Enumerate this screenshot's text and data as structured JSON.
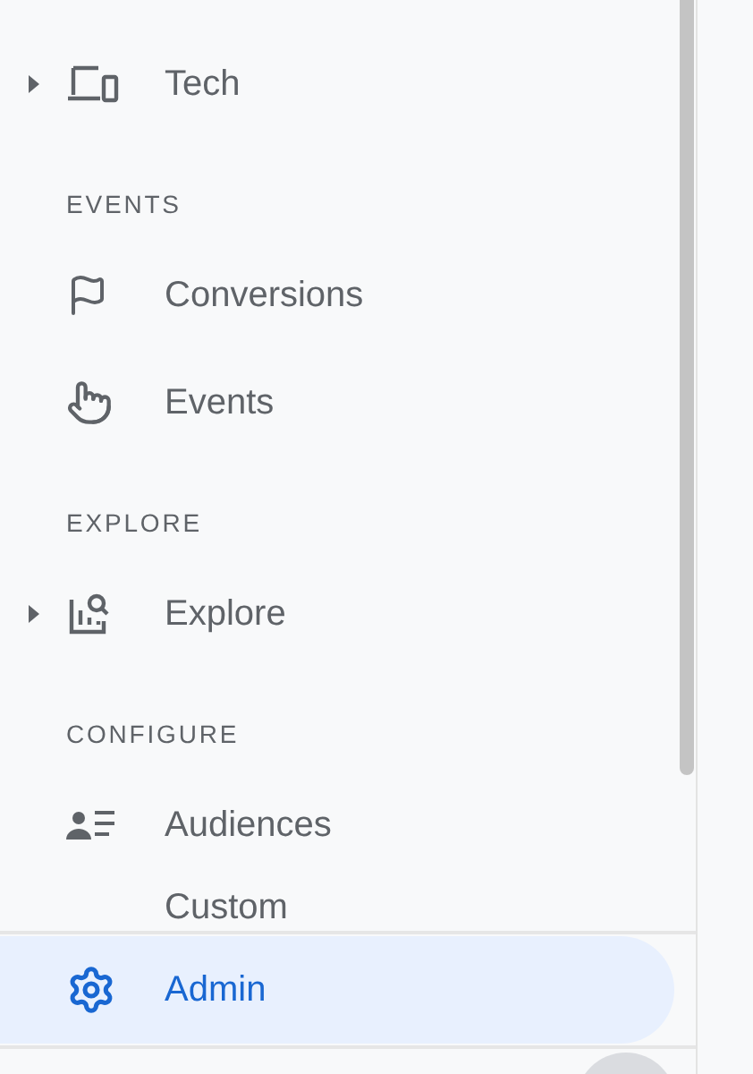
{
  "nav": [
    {
      "kind": "group",
      "label": "Tech",
      "expanded": false,
      "selected": false
    },
    {
      "kind": "header",
      "label": "EVENTS"
    },
    {
      "kind": "page",
      "label": "Conversions",
      "selected": false
    },
    {
      "kind": "page",
      "label": "Events",
      "selected": false
    },
    {
      "kind": "header",
      "label": "EXPLORE"
    },
    {
      "kind": "group",
      "label": "Explore",
      "expanded": false,
      "selected": false
    },
    {
      "kind": "header",
      "label": "CONFIGURE"
    },
    {
      "kind": "page",
      "label": "Audiences",
      "selected": false
    },
    {
      "kind": "page",
      "label": "Custom",
      "selected": false
    }
  ],
  "footer": {
    "label": "Admin",
    "selected": true
  }
}
